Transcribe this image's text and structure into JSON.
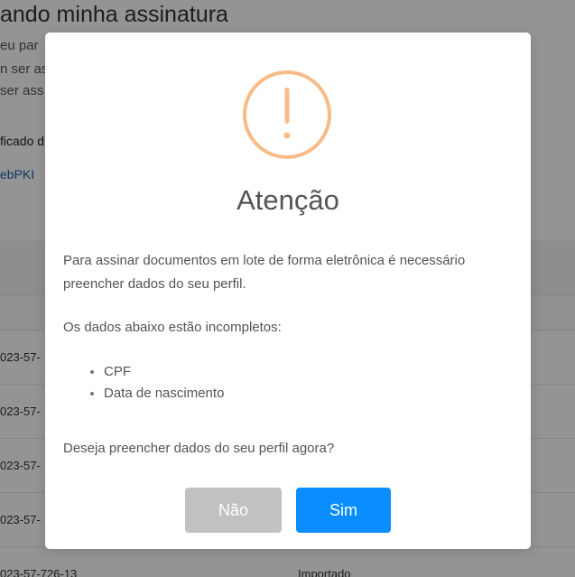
{
  "background": {
    "title": "ando minha assinatura",
    "lines": [
      "eu par",
      "n ser as",
      "ser ass"
    ],
    "certificate_label": "ficado d",
    "link_text": "ebPKI",
    "rows": [
      {
        "id": "023-57-",
        "status": ""
      },
      {
        "id": "023-57-",
        "status": ""
      },
      {
        "id": "023-57-",
        "status": ""
      },
      {
        "id": "023-57-",
        "status": ""
      },
      {
        "id": "023-57-726-13",
        "status": "Importado"
      }
    ]
  },
  "modal": {
    "icon": "warning-icon",
    "icon_color": "#f8bb86",
    "title": "Atenção",
    "intro": "Para assinar documentos em lote de forma eletrônica é necessário preencher dados do seu perfil.",
    "incomplete_label": "Os dados abaixo estão incompletos:",
    "missing_fields": [
      "CPF",
      "Data de nascimento"
    ],
    "question": "Deseja preencher dados do seu perfil agora?",
    "no_label": "Não",
    "yes_label": "Sim",
    "no_color": "#c1c1c1",
    "yes_color": "#0a8eff"
  }
}
